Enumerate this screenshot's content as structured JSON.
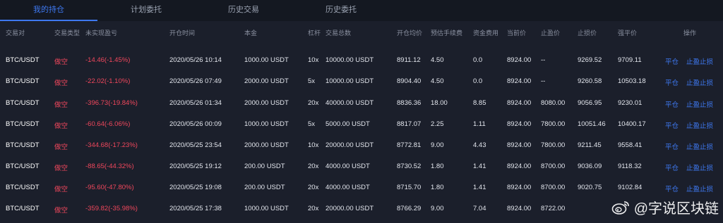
{
  "tabs": [
    {
      "label": "我的持仓",
      "active": true
    },
    {
      "label": "计划委托",
      "active": false
    },
    {
      "label": "历史交易",
      "active": false
    },
    {
      "label": "历史委托",
      "active": false
    }
  ],
  "columns": [
    "交易对",
    "交易类型",
    "未实现盈亏",
    "开仓时间",
    "本金",
    "杠杆",
    "交易总数",
    "开仓均价",
    "预估手续费",
    "资金费用",
    "当前价",
    "止盈价",
    "止损价",
    "强平价",
    "操作"
  ],
  "rows": [
    {
      "pair": "BTC/USDT",
      "type": "做空",
      "pnl": "-14.46(-1.45%)",
      "time": "2020/05/26 10:14",
      "principal": "1000.00 USDT",
      "leverage": "10x",
      "total": "10000.00 USDT",
      "open_avg": "8911.12",
      "fee": "4.50",
      "funding": "0.0",
      "current": "8924.00",
      "take_profit": "--",
      "stop_loss": "9269.52",
      "liq": "9709.11",
      "close_label": "平仓",
      "tpsl_label": "止盈止损"
    },
    {
      "pair": "BTC/USDT",
      "type": "做空",
      "pnl": "-22.02(-1.10%)",
      "time": "2020/05/26 07:49",
      "principal": "2000.00 USDT",
      "leverage": "5x",
      "total": "10000.00 USDT",
      "open_avg": "8904.40",
      "fee": "4.50",
      "funding": "0.0",
      "current": "8924.00",
      "take_profit": "--",
      "stop_loss": "9260.58",
      "liq": "10503.18",
      "close_label": "平仓",
      "tpsl_label": "止盈止损"
    },
    {
      "pair": "BTC/USDT",
      "type": "做空",
      "pnl": "-396.73(-19.84%)",
      "time": "2020/05/26 01:34",
      "principal": "2000.00 USDT",
      "leverage": "20x",
      "total": "40000.00 USDT",
      "open_avg": "8836.36",
      "fee": "18.00",
      "funding": "8.85",
      "current": "8924.00",
      "take_profit": "8080.00",
      "stop_loss": "9056.95",
      "liq": "9230.01",
      "close_label": "平仓",
      "tpsl_label": "止盈止损"
    },
    {
      "pair": "BTC/USDT",
      "type": "做空",
      "pnl": "-60.64(-6.06%)",
      "time": "2020/05/26 00:09",
      "principal": "1000.00 USDT",
      "leverage": "5x",
      "total": "5000.00 USDT",
      "open_avg": "8817.07",
      "fee": "2.25",
      "funding": "1.11",
      "current": "8924.00",
      "take_profit": "7800.00",
      "stop_loss": "10051.46",
      "liq": "10400.17",
      "close_label": "平仓",
      "tpsl_label": "止盈止损"
    },
    {
      "pair": "BTC/USDT",
      "type": "做空",
      "pnl": "-344.68(-17.23%)",
      "time": "2020/05/25 23:54",
      "principal": "2000.00 USDT",
      "leverage": "10x",
      "total": "20000.00 USDT",
      "open_avg": "8772.81",
      "fee": "9.00",
      "funding": "4.43",
      "current": "8924.00",
      "take_profit": "7800.00",
      "stop_loss": "9211.45",
      "liq": "9558.41",
      "close_label": "平仓",
      "tpsl_label": "止盈止损"
    },
    {
      "pair": "BTC/USDT",
      "type": "做空",
      "pnl": "-88.65(-44.32%)",
      "time": "2020/05/25 19:12",
      "principal": "200.00 USDT",
      "leverage": "20x",
      "total": "4000.00 USDT",
      "open_avg": "8730.52",
      "fee": "1.80",
      "funding": "1.41",
      "current": "8924.00",
      "take_profit": "8700.00",
      "stop_loss": "9036.09",
      "liq": "9118.32",
      "close_label": "平仓",
      "tpsl_label": "止盈止损"
    },
    {
      "pair": "BTC/USDT",
      "type": "做空",
      "pnl": "-95.60(-47.80%)",
      "time": "2020/05/25 19:08",
      "principal": "200.00 USDT",
      "leverage": "20x",
      "total": "4000.00 USDT",
      "open_avg": "8715.70",
      "fee": "1.80",
      "funding": "1.41",
      "current": "8924.00",
      "take_profit": "8700.00",
      "stop_loss": "9020.75",
      "liq": "9102.84",
      "close_label": "平仓",
      "tpsl_label": "止盈止损"
    },
    {
      "pair": "BTC/USDT",
      "type": "做空",
      "pnl": "-359.82(-35.98%)",
      "time": "2020/05/25 17:38",
      "principal": "1000.00 USDT",
      "leverage": "20x",
      "total": "20000.00 USDT",
      "open_avg": "8766.29",
      "fee": "9.00",
      "funding": "7.04",
      "current": "8924.00",
      "take_profit": "8722.00",
      "stop_loss": "",
      "liq": "",
      "close_label": "",
      "tpsl_label": ""
    }
  ],
  "watermark": {
    "text": "@字说区块链",
    "icon": "weibo-icon"
  },
  "colors": {
    "accent": "#3e78f0",
    "short": "#f0475c",
    "bg": "#1b1f2b"
  }
}
